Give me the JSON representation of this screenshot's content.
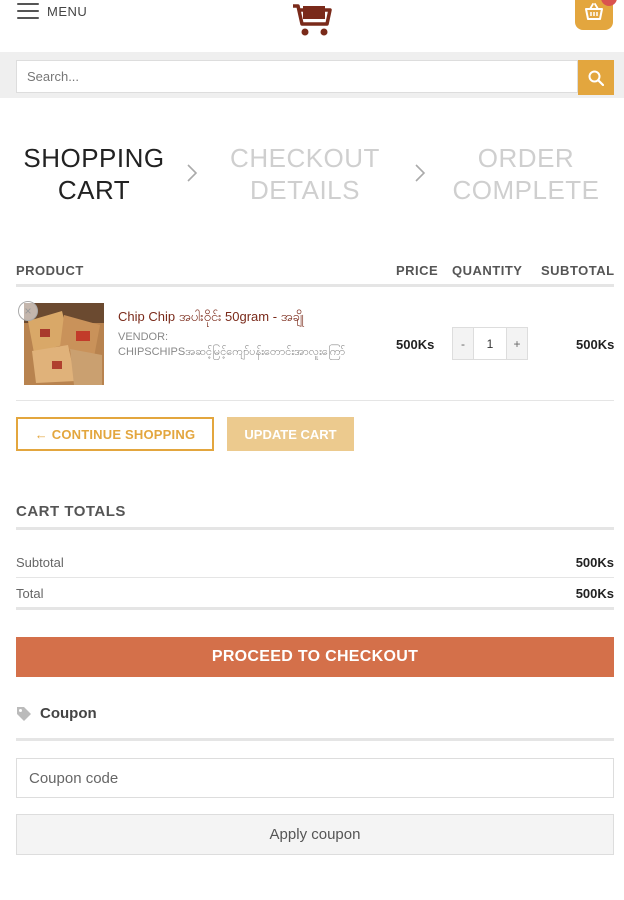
{
  "header": {
    "menu_label": "MENU",
    "logo_icon": "shopping-cart-logo-icon",
    "cart_icon": "basket-icon",
    "accent_color": "#e3a63e"
  },
  "search": {
    "placeholder": "Search...",
    "button_icon": "search-icon"
  },
  "steps": [
    {
      "line1": "SHOPPING",
      "line2": "CART",
      "active": true
    },
    {
      "line1": "CHECKOUT",
      "line2": "DETAILS",
      "active": false
    },
    {
      "line1": "ORDER",
      "line2": "COMPLETE",
      "active": false
    }
  ],
  "table": {
    "headers": {
      "product": "PRODUCT",
      "price": "PRICE",
      "quantity": "QUANTITY",
      "subtotal": "SUBTOTAL"
    },
    "rows": [
      {
        "name": "Chip Chip အပါးဝိုင်း 50gram - အချို",
        "vendor_label": "VENDOR:",
        "vendor_value": "CHIPSCHIPSအဆင့်မြင့်ကျော်ပန်းတောင်းအာလူးကြော်",
        "price": "500Ks",
        "quantity": "1",
        "qty_minus": "-",
        "qty_plus": "+",
        "subtotal": "500Ks"
      }
    ]
  },
  "buttons": {
    "continue_shopping": "← CONTINUE SHOPPING",
    "update_cart": "UPDATE CART",
    "proceed_checkout": "PROCEED TO CHECKOUT",
    "apply_coupon": "Apply coupon"
  },
  "totals": {
    "title": "CART TOTALS",
    "subtotal_label": "Subtotal",
    "subtotal_value": "500Ks",
    "total_label": "Total",
    "total_value": "500Ks"
  },
  "coupon": {
    "label": "Coupon",
    "icon": "tag-icon",
    "placeholder": "Coupon code"
  },
  "colors": {
    "checkout": "#d4704a",
    "update": "#ecca8e",
    "brand_dark": "#7a2a1a"
  }
}
